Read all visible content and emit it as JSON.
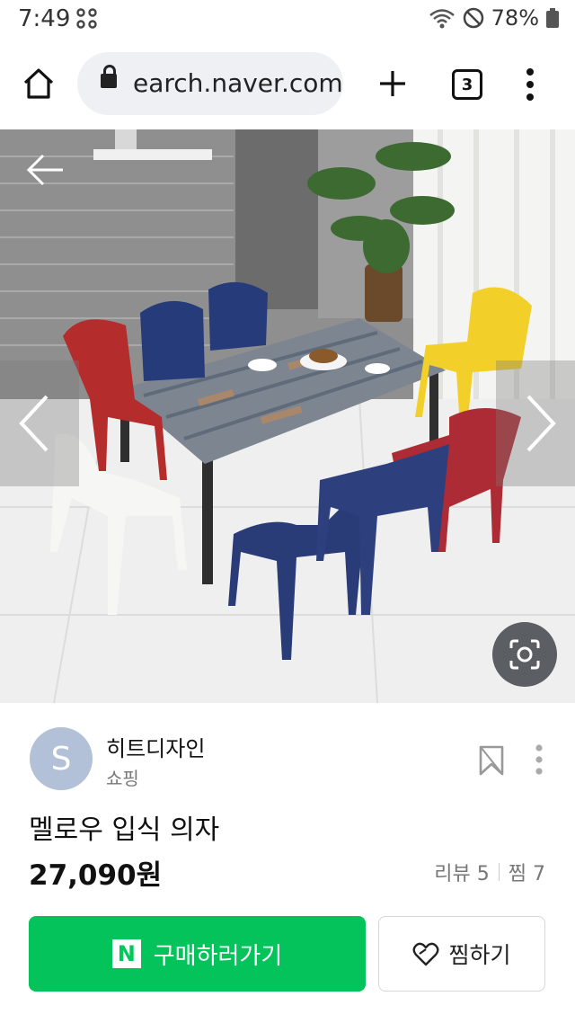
{
  "status_bar": {
    "time": "7:49",
    "battery": "78%"
  },
  "browser": {
    "url": "earch.naver.com",
    "tab_count": "3"
  },
  "product": {
    "seller_initial": "S",
    "seller_name": "히트디자인",
    "seller_category": "쇼핑",
    "title": "멜로우 입식 의자",
    "price": "27,090원",
    "review_label": "리뷰 5",
    "wish_label": "찜 7"
  },
  "actions": {
    "buy_label": "구매하러가기",
    "buy_logo": "N",
    "favorite_label": "찜하기"
  },
  "icons": {
    "home": "home-icon",
    "lock": "lock-icon",
    "plus": "plus-icon",
    "more": "more-vertical-icon",
    "back": "arrow-left-icon",
    "prev": "chevron-left-icon",
    "next": "chevron-right-icon",
    "lens": "image-search-icon",
    "bookmark": "bookmark-icon",
    "heart": "heart-icon"
  },
  "colors": {
    "accent_green": "#05c35b",
    "avatar_bg": "#b2c1d7"
  }
}
